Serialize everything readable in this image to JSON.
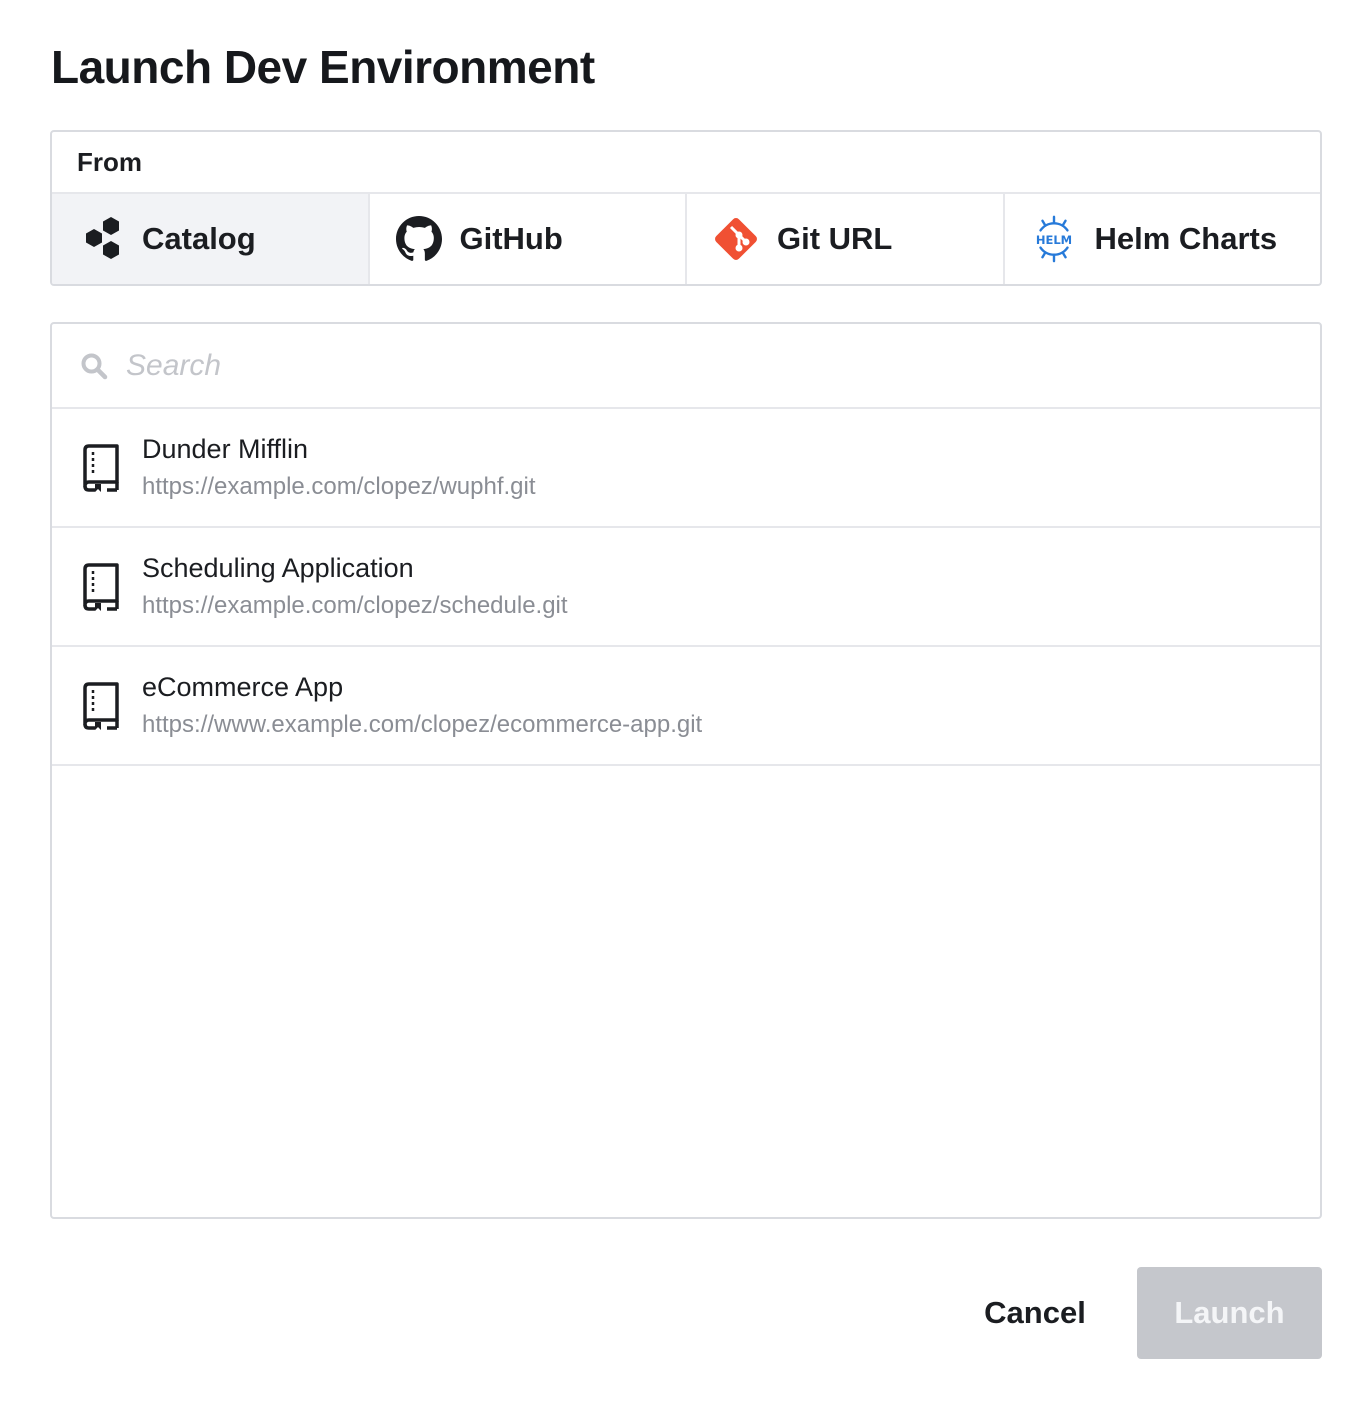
{
  "dialog": {
    "title": "Launch Dev Environment"
  },
  "source": {
    "header": "From",
    "tabs": [
      {
        "label": "Catalog",
        "icon": "catalog-hexagons-icon",
        "active": true
      },
      {
        "label": "GitHub",
        "icon": "github-icon",
        "active": false
      },
      {
        "label": "Git URL",
        "icon": "git-icon",
        "active": false
      },
      {
        "label": "Helm Charts",
        "icon": "helm-icon",
        "active": false
      }
    ]
  },
  "search": {
    "placeholder": "Search",
    "value": ""
  },
  "repos": [
    {
      "name": "Dunder Mifflin",
      "url": "https://example.com/clopez/wuphf.git"
    },
    {
      "name": "Scheduling Application",
      "url": "https://example.com/clopez/schedule.git"
    },
    {
      "name": "eCommerce App",
      "url": "https://www.example.com/clopez/ecommerce-app.git"
    }
  ],
  "footer": {
    "cancel_label": "Cancel",
    "launch_label": "Launch",
    "launch_enabled": false
  },
  "colors": {
    "git_orange": "#f05033",
    "helm_blue": "#277ad9",
    "active_tab_bg": "#f2f3f6",
    "disabled_button_bg": "#c5c7cc"
  }
}
